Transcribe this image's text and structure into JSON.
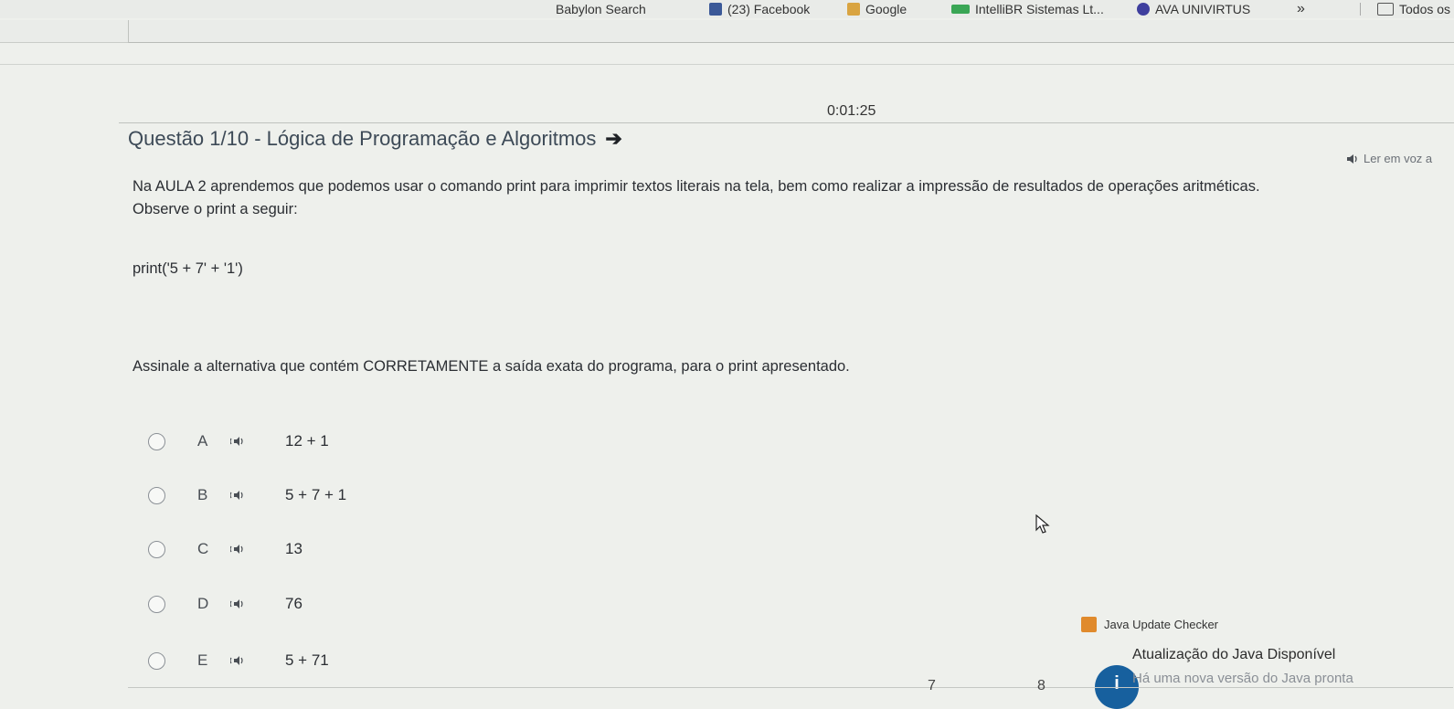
{
  "bookmarks": {
    "items": [
      {
        "label": "Babylon Search"
      },
      {
        "label": "(23) Facebook"
      },
      {
        "label": "Google"
      },
      {
        "label": "IntelliBR Sistemas Lt..."
      },
      {
        "label": "AVA UNIVIRTUS"
      }
    ],
    "overflow": "»",
    "all_label": "Todos os"
  },
  "timer": "0:01:25",
  "question": {
    "title": "Questão 1/10 - Lógica de Programação e Algoritmos",
    "arrow": "➔",
    "read_aloud": "Ler em voz a",
    "paragraph1": "Na AULA 2 aprendemos que podemos usar o comando print para imprimir textos literais na tela, bem como realizar a impressão de resultados de operações aritméticas.",
    "paragraph2": "Observe o print a seguir:",
    "code": "print('5 + 7' + '1')",
    "prompt": "Assinale a alternativa que contém CORRETAMENTE a saída exata do programa, para o print apresentado."
  },
  "options": [
    {
      "letter": "A",
      "value": "12 + 1"
    },
    {
      "letter": "B",
      "value": "5 + 7 + 1"
    },
    {
      "letter": "C",
      "value": "13"
    },
    {
      "letter": "D",
      "value": "76"
    },
    {
      "letter": "E",
      "value": "5 + 71"
    }
  ],
  "icons": {
    "speaker": "speaker-icon",
    "info": "info-icon"
  },
  "java_notification": {
    "app": "Java Update Checker",
    "title": "Atualização do Java Disponível",
    "message": "Há uma nova versão do Java pronta",
    "info_glyph": "i"
  },
  "pagination": {
    "seven": "7",
    "eight": "8"
  }
}
